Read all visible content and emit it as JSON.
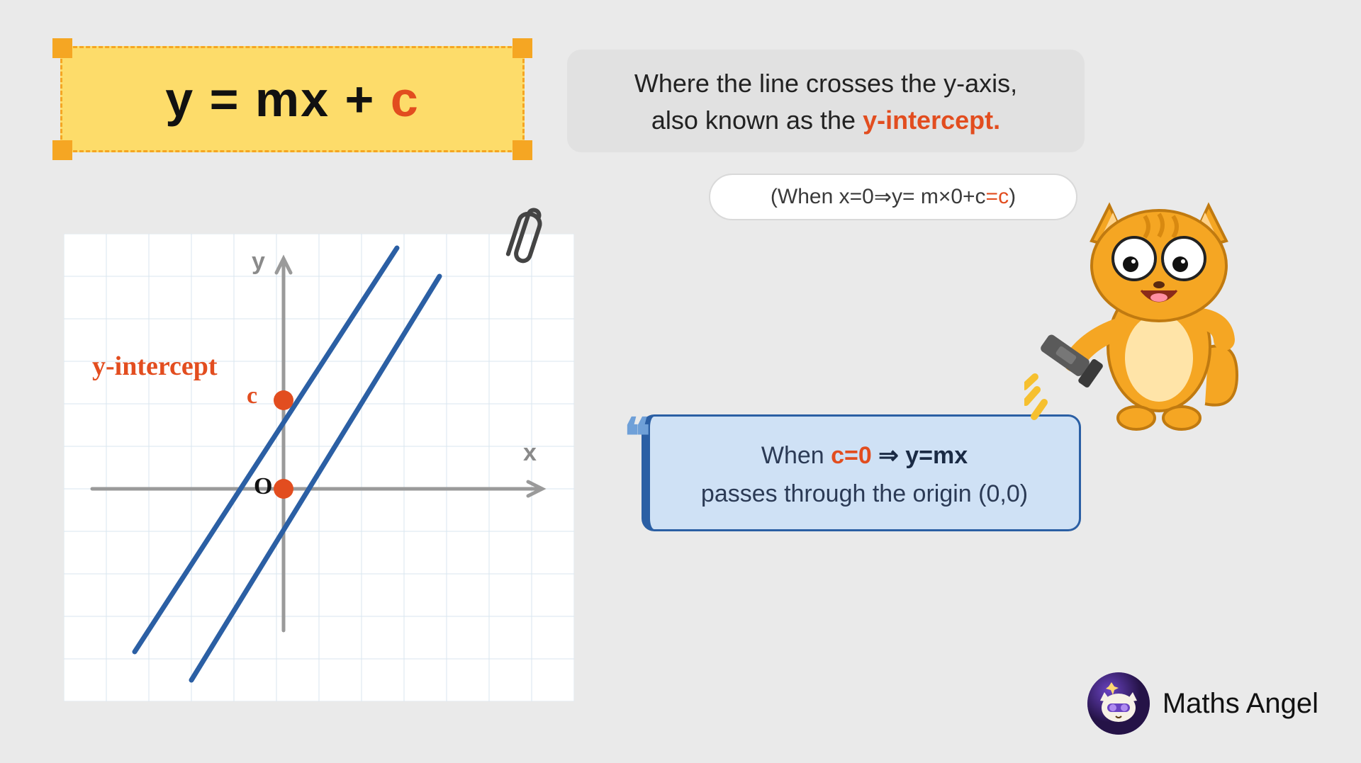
{
  "equation": {
    "lhs": "y = mx ",
    "plus": "+ ",
    "c": "c"
  },
  "description": {
    "line1": "Where the line crosses the y-axis,",
    "line2_pre": "also known as the ",
    "line2_hl": "y-intercept."
  },
  "formula": {
    "open": "( ",
    "p1": "When x=0 ",
    "arrow": "⇒",
    "p2": " y= m×0+c",
    "eq": "=",
    "c": "c",
    "close": " )"
  },
  "graph": {
    "y_intercept_label": "y-intercept",
    "c_label": "c",
    "origin_label": "O",
    "y_axis": "y",
    "x_axis": "x"
  },
  "callout": {
    "pre": "When ",
    "c0": "c=0",
    "arrow": " ⇒ ",
    "eq": "y=mx",
    "line2": "passes through the origin (0,0)"
  },
  "brand": {
    "name": "Maths Angel"
  },
  "quote_glyph": "❝"
}
